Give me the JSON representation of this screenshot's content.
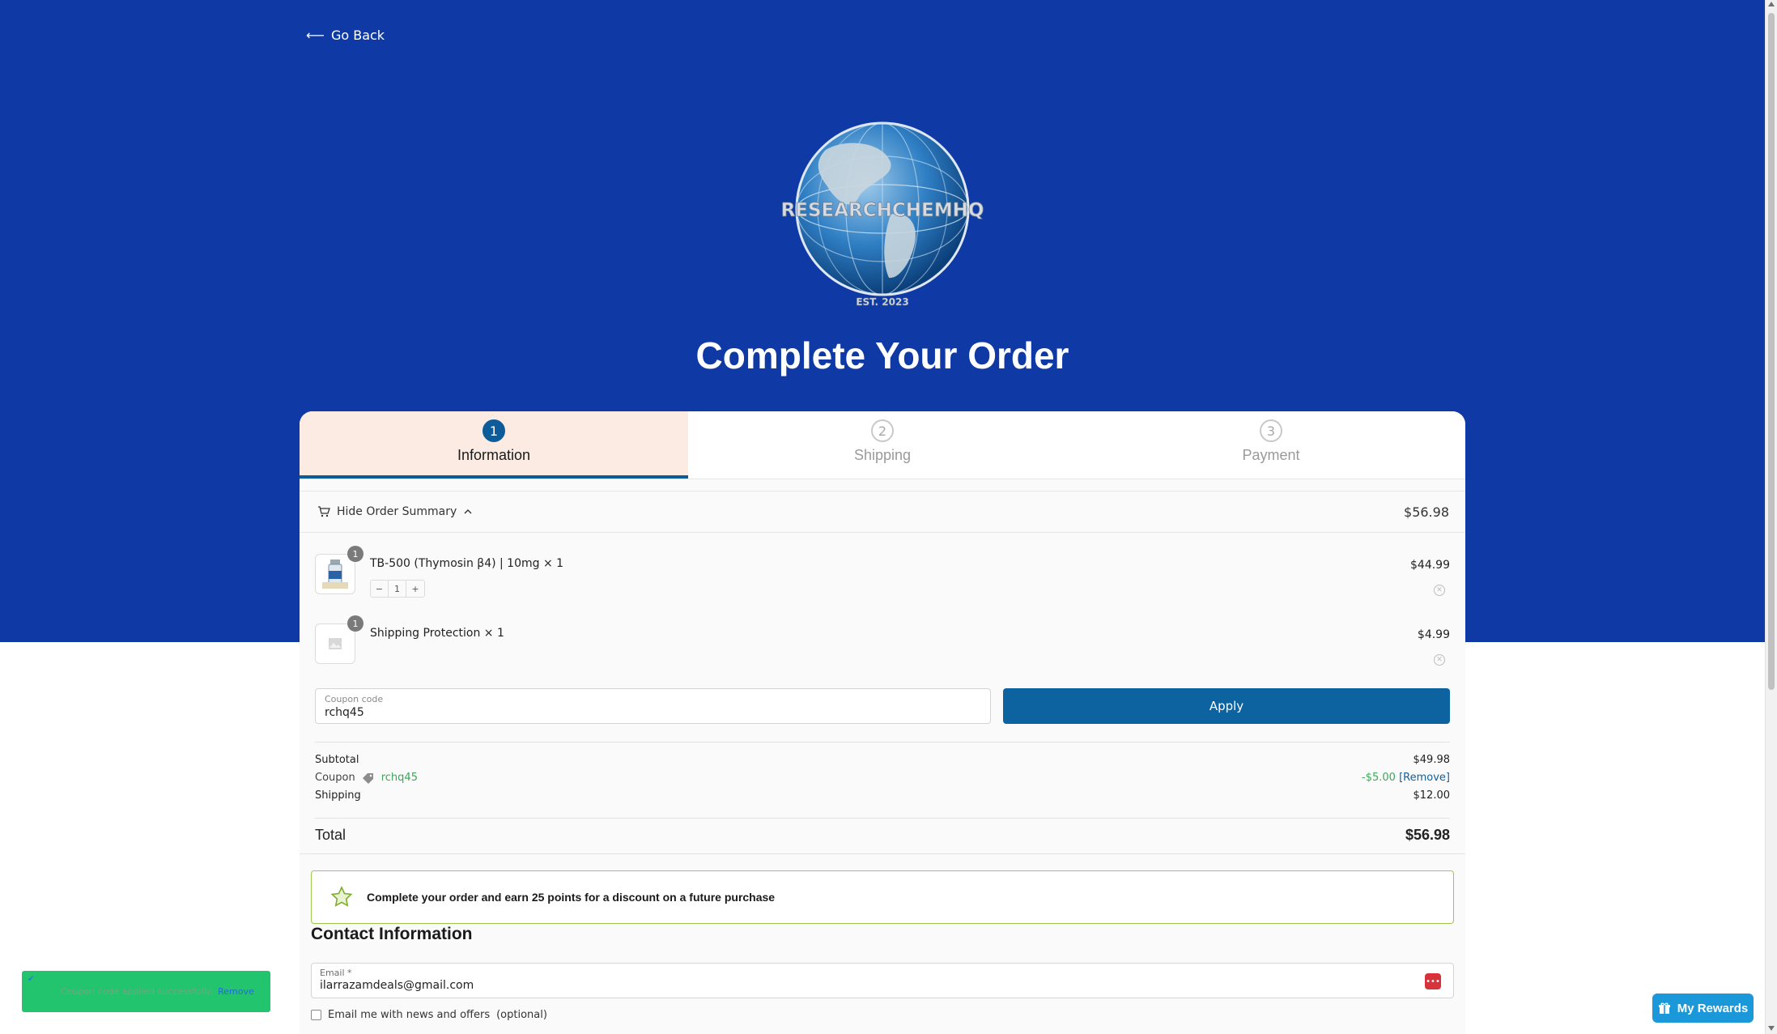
{
  "nav": {
    "go_back_label": "Go Back"
  },
  "logo": {
    "text": "RESEARCHCHEMHQ",
    "est": "EST. 2023"
  },
  "page": {
    "title": "Complete Your Order"
  },
  "steps": [
    {
      "number": "1",
      "label": "Information",
      "active": true
    },
    {
      "number": "2",
      "label": "Shipping",
      "active": false
    },
    {
      "number": "3",
      "label": "Payment",
      "active": false
    }
  ],
  "summary": {
    "toggle_label": "Hide Order Summary",
    "amount": "$56.98"
  },
  "items": [
    {
      "name": "TB-500 (Thymosin β4) | 10mg × 1",
      "price": "$44.99",
      "qty": "1",
      "qty_minus": "−",
      "qty_plus": "+",
      "badge": "1"
    },
    {
      "name": "Shipping Protection × 1",
      "price": "$4.99",
      "badge": "1"
    }
  ],
  "coupon": {
    "label": "Coupon code",
    "value": "rchq45",
    "apply_label": "Apply"
  },
  "totals": {
    "subtotal_label": "Subtotal",
    "subtotal": "$49.98",
    "coupon_label": "Coupon",
    "coupon_code": "rchq45",
    "coupon_amount": "-$5.00",
    "coupon_remove": "[Remove]",
    "shipping_label": "Shipping",
    "shipping": "$12.00",
    "total_label": "Total",
    "total": "$56.98"
  },
  "rewards_banner": {
    "text": "Complete your order and earn 25 points for a discount on a future purchase"
  },
  "contact": {
    "heading": "Contact Information",
    "email_label": "Email *",
    "email_value": "ilarrazamdeals@gmail.com",
    "newsletter_label": "Email me with news and offers",
    "newsletter_optional": "(optional)"
  },
  "toast": {
    "message": "Coupon code applied successfully.",
    "remove_label": "Remove"
  },
  "rewards_button": {
    "label": "My Rewards"
  },
  "colors": {
    "hero_bg": "#0f3aa6",
    "accent": "#0d62a0",
    "active_step_bg": "#fcebe2",
    "toast_bg": "#22c46d",
    "rewards_btn": "#1a98d9"
  }
}
